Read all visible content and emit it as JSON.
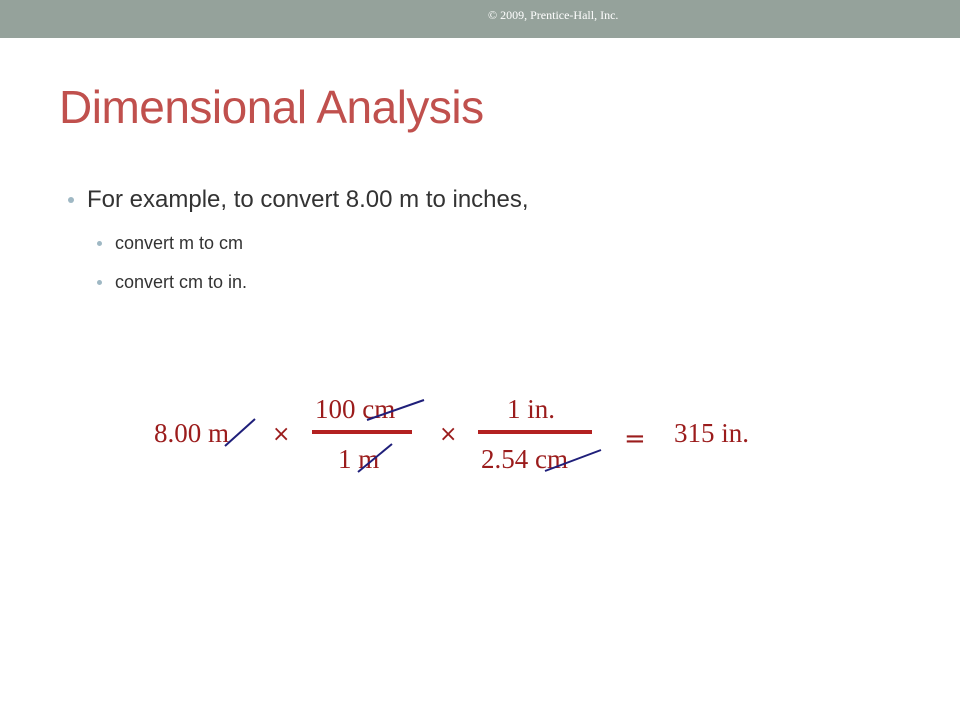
{
  "header": {
    "copyright": "© 2009, Prentice-Hall, Inc."
  },
  "slide": {
    "title": "Dimensional Analysis",
    "bullets": [
      "For example,  to convert 8.00 m to inches,",
      "convert m to cm",
      "convert cm to in."
    ]
  },
  "equation": {
    "start": "8.00 m",
    "times": "×",
    "frac1_num": "100 cm",
    "frac1_den": "1 m",
    "frac2_num": "1 in.",
    "frac2_den": "2.54 cm",
    "equals": "=",
    "result": "315 in."
  },
  "colors": {
    "title": "#c0504d",
    "equation": "#9b1c1c",
    "cancel_strike": "#1f1f7a",
    "header_bar": "#95a29b"
  }
}
